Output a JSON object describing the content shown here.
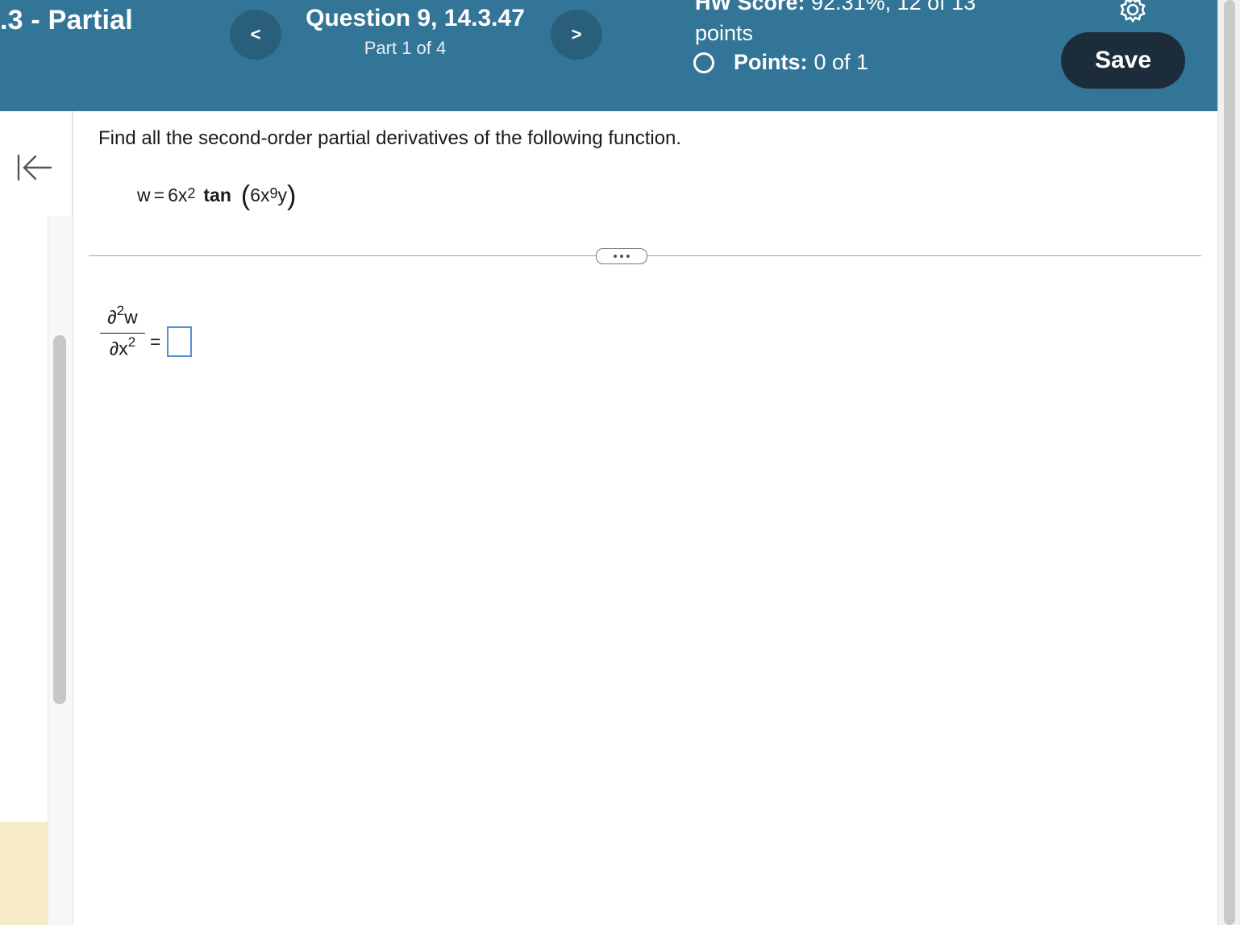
{
  "header": {
    "section_title": ".3 - Partial",
    "question_title": "Question 9, 14.3.47",
    "part_label": "Part 1 of 4",
    "prev_glyph": "<",
    "next_glyph": ">",
    "hw_score_label": "HW Score:",
    "hw_score_value": "92.31%, 12 of 13",
    "hw_score_unit": "points",
    "points_label": "Points:",
    "points_value": "0 of 1",
    "save_label": "Save",
    "settings_icon": "gear-icon"
  },
  "sidebar": {
    "collapse_icon": "collapse-left-icon"
  },
  "question": {
    "instruction": "Find all the second-order partial derivatives of the following function.",
    "function": {
      "lhs": "w",
      "eq": "=",
      "coef": "6x",
      "coef_exp": "2",
      "func": "tan",
      "arg_coef": "6x",
      "arg_exp": "9",
      "arg_var": "y"
    },
    "more_button": "more-options-icon",
    "derivative": {
      "num_symbol": "∂",
      "num_exp": "2",
      "num_var": "w",
      "den_symbol": "∂x",
      "den_exp": "2",
      "equals": "="
    },
    "answer_value": ""
  },
  "colors": {
    "header_bg": "#337596",
    "nav_button_bg": "#2a5f7c",
    "save_bg": "#1c2c3a",
    "answer_border": "#5b8ed6",
    "sidebar_highlight": "#f8ebc7"
  }
}
